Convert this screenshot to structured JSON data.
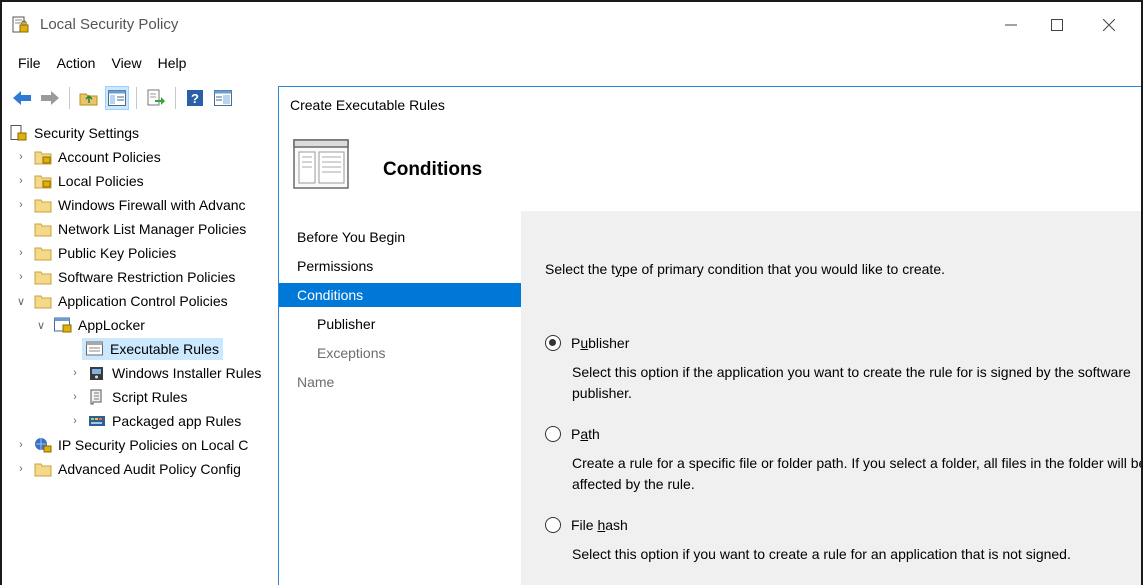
{
  "window": {
    "title": "Local Security Policy",
    "controls": {
      "minimize": "—",
      "maximize": "☐",
      "close": "✕"
    }
  },
  "menu": [
    "File",
    "Action",
    "View",
    "Help"
  ],
  "toolbar": {
    "icons": [
      "back-arrow-icon",
      "forward-arrow-icon",
      "up-folder-icon",
      "show-hide-tree-icon",
      "export-list-icon",
      "help-icon",
      "properties-icon"
    ]
  },
  "tree": {
    "root": "Security Settings",
    "items": [
      {
        "label": "Account Policies"
      },
      {
        "label": "Local Policies"
      },
      {
        "label": "Windows Firewall with Advanc"
      },
      {
        "label": "Network List Manager Policies"
      },
      {
        "label": "Public Key Policies"
      },
      {
        "label": "Software Restriction Policies"
      },
      {
        "label": "Application Control Policies"
      },
      {
        "label": "AppLocker"
      },
      {
        "label": "Executable Rules"
      },
      {
        "label": "Windows Installer Rules"
      },
      {
        "label": "Script Rules"
      },
      {
        "label": "Packaged app Rules"
      },
      {
        "label": "IP Security Policies on Local C"
      },
      {
        "label": "Advanced Audit Policy Config"
      }
    ]
  },
  "dialog": {
    "title": "Create Executable Rules",
    "heading": "Conditions",
    "steps": [
      {
        "label": "Before You Begin"
      },
      {
        "label": "Permissions"
      },
      {
        "label": "Conditions"
      },
      {
        "label": "Publisher"
      },
      {
        "label": "Exceptions"
      },
      {
        "label": "Name"
      }
    ],
    "prompt_pre": "Select the t",
    "prompt_key": "y",
    "prompt_post": "pe of primary condition that you would like to create.",
    "options": [
      {
        "pre": "P",
        "key": "u",
        "post": "blisher",
        "checked": true,
        "desc": "Select this option if the application you want to create the rule for is signed by the software publisher."
      },
      {
        "pre": "P",
        "key": "a",
        "post": "th",
        "checked": false,
        "desc": "Create a rule for a specific file or folder path. If you select a folder, all files in the folder will be affected by the rule."
      },
      {
        "pre": "File ",
        "key": "h",
        "post": "ash",
        "checked": false,
        "desc": "Select this option if you want to create a rule for an application that is not signed."
      }
    ]
  },
  "colors": {
    "selection": "#cce8ff",
    "active_step": "#0078d7",
    "dialog_border": "#2a86d8",
    "content_bg": "#f0f0f0"
  }
}
